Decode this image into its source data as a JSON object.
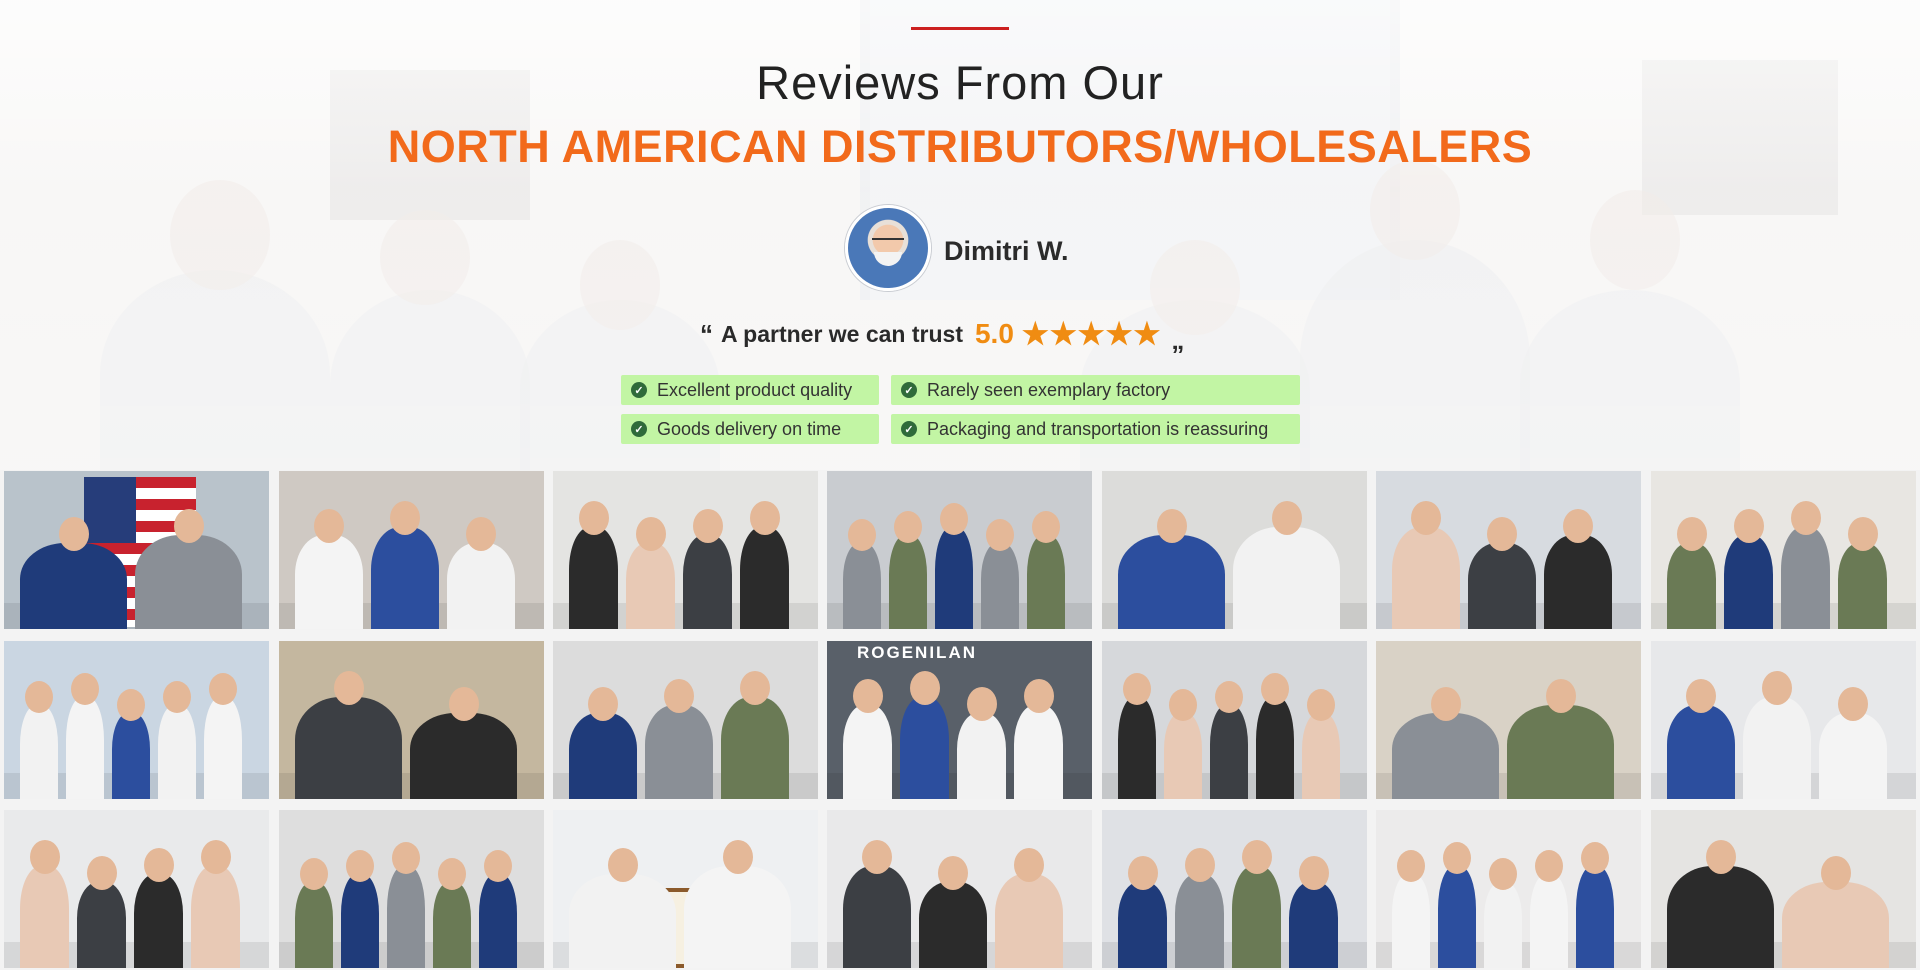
{
  "heading": {
    "line1": "Reviews From Our",
    "line2": "NORTH AMERICAN DISTRIBUTORS/WHOLESALERS"
  },
  "reviewer": {
    "name": "Dimitri W.",
    "avatar_icon": "reviewer-avatar"
  },
  "review": {
    "open_quote": "“",
    "text": "A partner we can trust",
    "rating": "5.0",
    "stars": "★★★★★",
    "rating_value": 5,
    "close_quote": "„"
  },
  "tags": [
    "Excellent product quality",
    "Rarely seen exemplary factory",
    "Goods delivery on time",
    "Packaging and transportation is reassuring"
  ],
  "photo_grid": {
    "logo_text": "ROGENILAN",
    "photos": [
      "distributor-photo-1",
      "distributor-photo-2",
      "distributor-photo-3",
      "distributor-photo-4",
      "distributor-photo-5",
      "distributor-photo-6",
      "distributor-photo-7",
      "distributor-photo-8",
      "distributor-photo-9",
      "distributor-photo-10",
      "distributor-photo-11",
      "distributor-photo-12",
      "distributor-photo-13",
      "distributor-photo-14",
      "distributor-photo-15",
      "distributor-photo-16",
      "distributor-photo-17",
      "distributor-photo-18",
      "distributor-photo-19",
      "distributor-photo-20",
      "distributor-photo-21"
    ]
  },
  "colors": {
    "accent_line": "#cc1f1f",
    "title_orange": "#f26a1b",
    "rating_orange": "#f08c12",
    "tag_green": "#c2f5a4",
    "check_green": "#2f6b3a"
  }
}
